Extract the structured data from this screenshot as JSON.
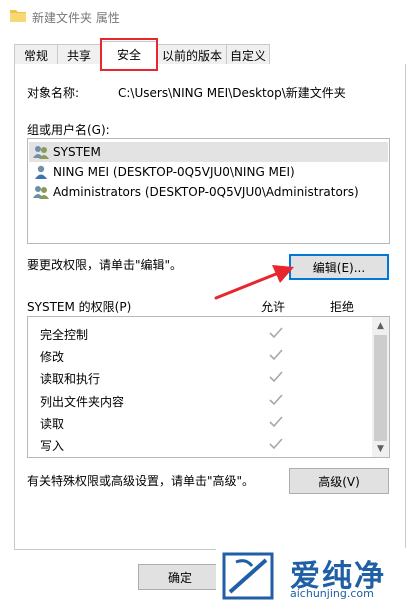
{
  "window": {
    "title": "新建文件夹 属性"
  },
  "tabs": [
    {
      "label": "常规",
      "active": false
    },
    {
      "label": "共享",
      "active": false
    },
    {
      "label": "安全",
      "active": true
    },
    {
      "label": "以前的版本",
      "active": false
    },
    {
      "label": "自定义",
      "active": false
    }
  ],
  "object": {
    "label": "对象名称:",
    "value": "C:\\Users\\NING MEI\\Desktop\\新建文件夹"
  },
  "groups": {
    "label": "组或用户名(G):",
    "items": [
      {
        "name": "SYSTEM",
        "icon": "group-users-icon",
        "selected": true
      },
      {
        "name": "NING MEI (DESKTOP-0Q5VJU0\\NING MEI)",
        "icon": "user-icon",
        "selected": false
      },
      {
        "name": "Administrators (DESKTOP-0Q5VJU0\\Administrators)",
        "icon": "group-users-icon",
        "selected": false
      }
    ]
  },
  "edit": {
    "hint": "要更改权限，请单击\"编辑\"。",
    "button": "编辑(E)..."
  },
  "permissions": {
    "title": "SYSTEM 的权限(P)",
    "allow_label": "允许",
    "deny_label": "拒绝",
    "items": [
      {
        "name": "完全控制",
        "allow": true,
        "deny": false
      },
      {
        "name": "修改",
        "allow": true,
        "deny": false
      },
      {
        "name": "读取和执行",
        "allow": true,
        "deny": false
      },
      {
        "name": "列出文件夹内容",
        "allow": true,
        "deny": false
      },
      {
        "name": "读取",
        "allow": true,
        "deny": false
      },
      {
        "name": "写入",
        "allow": true,
        "deny": false
      }
    ]
  },
  "advanced": {
    "hint": "有关特殊权限或高级设置，请单击\"高级\"。",
    "button": "高级(V)"
  },
  "footer": {
    "ok_button": "确定"
  },
  "watermark": {
    "brand": "爱纯净",
    "url": "aichunjing.com"
  },
  "colors": {
    "highlight_red": "#e8262d",
    "check_gray": "#a8a8a8",
    "selected_row": "#e3e3e3",
    "watermark_blue": "#1f5fa5"
  }
}
